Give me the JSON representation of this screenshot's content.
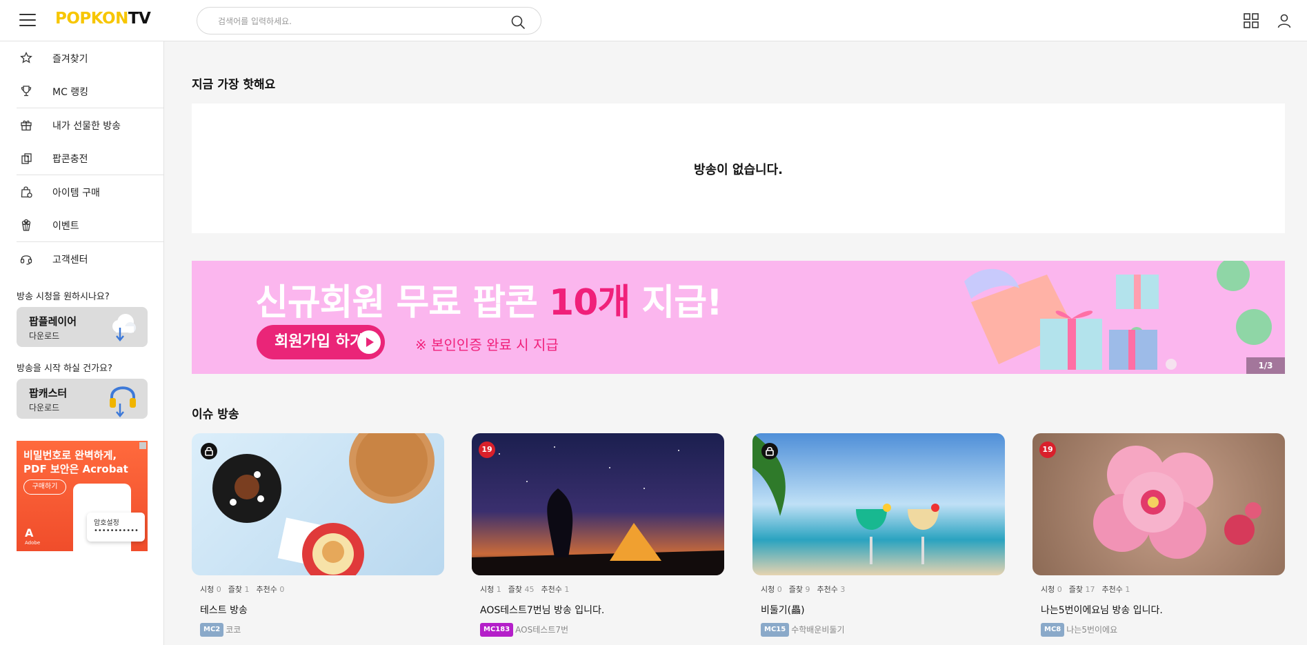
{
  "header": {
    "logo_part1": "POPKON",
    "logo_part2": "TV",
    "search_placeholder": "검색어를 입력하세요.",
    "search_icon": "search-icon",
    "grid_icon": "grid-icon",
    "user_icon": "user-icon",
    "menu_icon": "hamburger-icon",
    "logo_color": "#f7c600"
  },
  "sidebar": {
    "groups": [
      [
        {
          "label": "즐겨찾기",
          "icon": "star-icon"
        },
        {
          "label": "MC 랭킹",
          "icon": "trophy-icon"
        }
      ],
      [
        {
          "label": "내가 선물한 방송",
          "icon": "gift-icon"
        },
        {
          "label": "팝콘충전",
          "icon": "popcorn-charge-icon"
        }
      ],
      [
        {
          "label": "아이템 구매",
          "icon": "shopping-bag-icon"
        },
        {
          "label": "이벤트",
          "icon": "popcorn-icon"
        }
      ],
      [
        {
          "label": "고객센터",
          "icon": "headset-icon"
        }
      ]
    ],
    "watch_question": "방송 시청을 원하시나요?",
    "player_download": {
      "title": "팝플레이어",
      "sub": "다운로드",
      "icon": "cloud-download-icon"
    },
    "start_question": "방송을 시작 하실 건가요?",
    "caster_download": {
      "title": "팝캐스터",
      "sub": "다운로드",
      "icon": "headphone-download-icon"
    },
    "ad": {
      "line1": "비밀번호로 완벽하게,",
      "line2": "PDF 보안은 Acrobat",
      "button": "구매하기",
      "popup": "암호설정",
      "brand": "Adobe"
    }
  },
  "main": {
    "hot_title": "지금 가장 핫해요",
    "empty_message": "방송이 없습니다.",
    "banner": {
      "headline_pre": "신규회원 무료 팝콘 ",
      "headline_highlight": "10개",
      "headline_post": " 지급!",
      "join_button": "회원가입 하기",
      "note": "※ 본인인증 완료 시 지급",
      "counter": "1/3",
      "bg_color": "#fbb6ee",
      "accent": "#ea2578"
    },
    "issue_title": "이슈 방송",
    "stat_labels": {
      "view": "시청",
      "fav": "즐찾",
      "rec": "추천수"
    },
    "cards": [
      {
        "badge": "lock",
        "views": "0",
        "favs": "1",
        "recs": "0",
        "title": "테스트 방송",
        "mc": "MC2",
        "mc_color": "#8aa9c9",
        "name": "코코"
      },
      {
        "badge": "19",
        "views": "1",
        "favs": "45",
        "recs": "1",
        "title": "AOS테스트7번님 방송 입니다.",
        "mc": "MC183",
        "mc_color": "#b41fc9",
        "name": "AOS테스트7번"
      },
      {
        "badge": "lock",
        "views": "0",
        "favs": "9",
        "recs": "3",
        "title": "비둘기(畾)",
        "mc": "MC15",
        "mc_color": "#8aa9c9",
        "name": "수학배운비둘기"
      },
      {
        "badge": "19",
        "views": "0",
        "favs": "17",
        "recs": "1",
        "title": "나는5번이에요님 방송 입니다.",
        "mc": "MC8",
        "mc_color": "#8aa9c9",
        "name": "나는5번이에요"
      }
    ]
  }
}
